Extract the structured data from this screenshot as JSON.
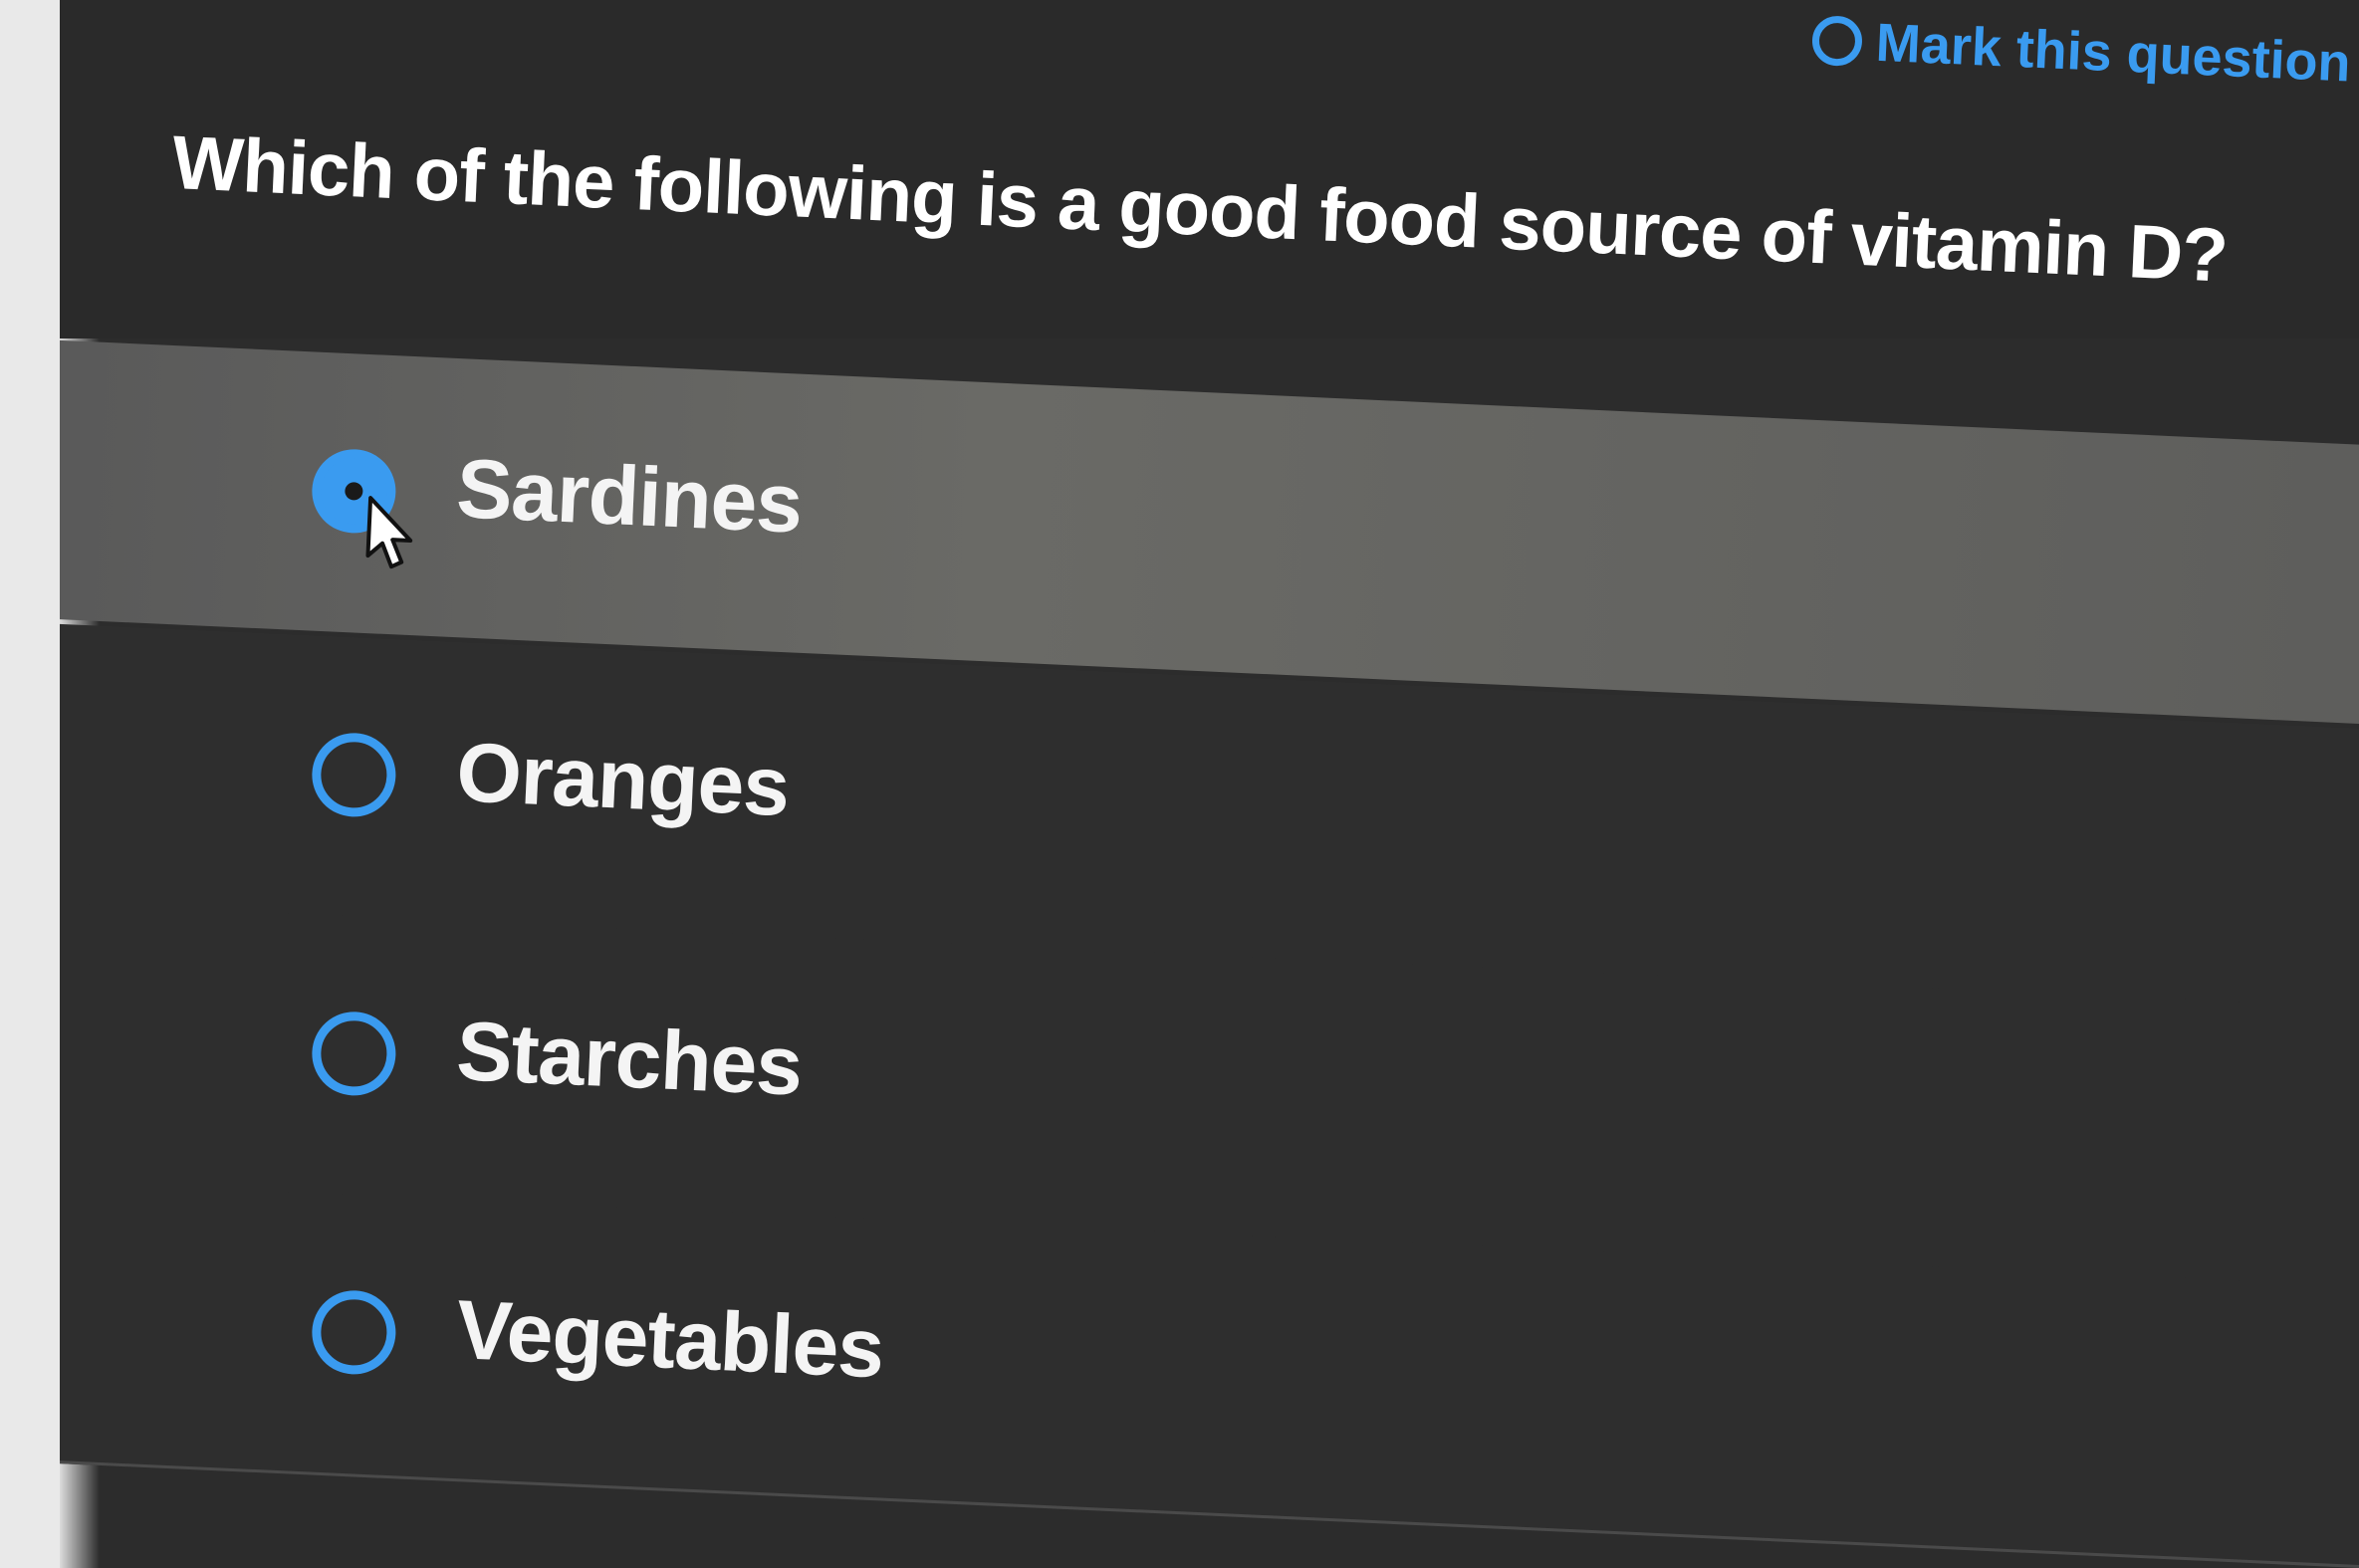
{
  "header": {
    "mark_label": "Mark this question"
  },
  "question": {
    "text": "Which of the following is a good food source of vitamin D?"
  },
  "options": [
    {
      "label": "Sardines",
      "selected": true
    },
    {
      "label": "Oranges",
      "selected": false
    },
    {
      "label": "Starches",
      "selected": false
    },
    {
      "label": "Vegetables",
      "selected": false
    }
  ],
  "colors": {
    "accent": "#3a9bf0",
    "background": "#2c2c2c",
    "selected_row": "#636361",
    "text": "#f4f4f4"
  },
  "icons": {
    "mark": "radio-ring-icon",
    "cursor": "mouse-pointer-icon"
  }
}
